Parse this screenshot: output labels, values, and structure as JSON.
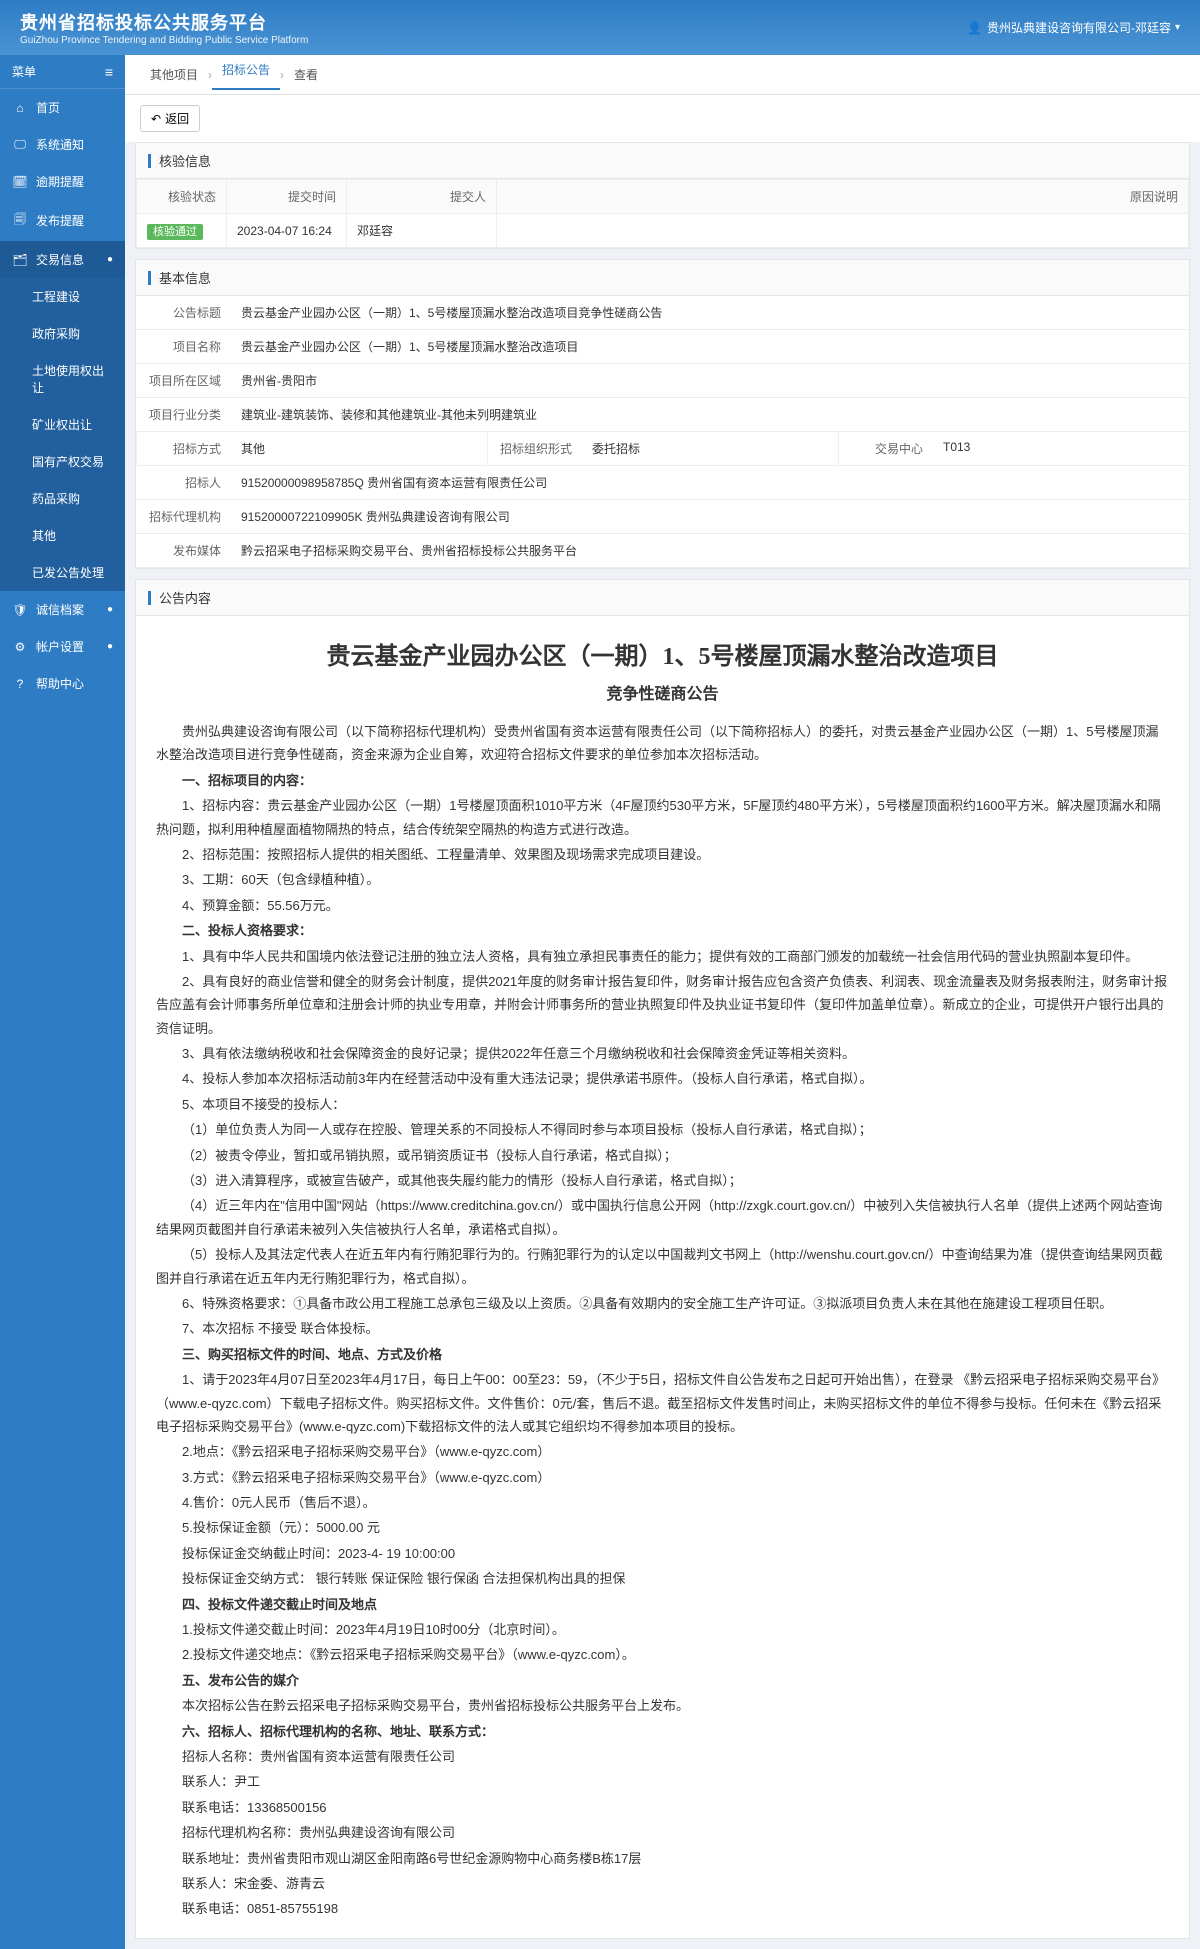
{
  "header": {
    "title": "贵州省招标投标公共服务平台",
    "subtitle": "GuiZhou Province Tendering and Bidding Public Service Platform",
    "user": "贵州弘典建设咨询有限公司-邓廷容"
  },
  "sidebar": {
    "menu_label": "菜单",
    "items": [
      {
        "label": "首页",
        "icon": "home"
      },
      {
        "label": "系统通知",
        "icon": "monitor"
      },
      {
        "label": "逾期提醒",
        "icon": "calendar"
      },
      {
        "label": "发布提醒",
        "icon": "send"
      },
      {
        "label": "交易信息",
        "icon": "trade",
        "expanded": true,
        "children": [
          {
            "label": "工程建设"
          },
          {
            "label": "政府采购"
          },
          {
            "label": "土地使用权出让"
          },
          {
            "label": "矿业权出让"
          },
          {
            "label": "国有产权交易"
          },
          {
            "label": "药品采购"
          },
          {
            "label": "其他"
          },
          {
            "label": "已发公告处理"
          }
        ]
      },
      {
        "label": "诚信档案",
        "icon": "credit",
        "chev": true
      },
      {
        "label": "帐户设置",
        "icon": "account",
        "chev": true
      },
      {
        "label": "帮助中心",
        "icon": "help"
      }
    ]
  },
  "breadcrumb": [
    "其他项目",
    "招标公告",
    "查看"
  ],
  "return_btn": "返回",
  "verify": {
    "title": "核验信息",
    "headers": [
      "核验状态",
      "提交时间",
      "提交人",
      "原因说明"
    ],
    "row": {
      "status": "核验通过",
      "time": "2023-04-07 16:24",
      "person": "邓廷容",
      "reason": ""
    }
  },
  "basic": {
    "title": "基本信息",
    "rows": [
      {
        "label": "公告标题",
        "value": "贵云基金产业园办公区（一期）1、5号楼屋顶漏水整治改造项目竞争性磋商公告"
      },
      {
        "label": "项目名称",
        "value": "贵云基金产业园办公区（一期）1、5号楼屋顶漏水整治改造项目"
      },
      {
        "label": "项目所在区域",
        "value": "贵州省-贵阳市"
      },
      {
        "label": "项目行业分类",
        "value": "建筑业-建筑装饰、装修和其他建筑业-其他未列明建筑业"
      }
    ],
    "multi": [
      {
        "label": "招标方式",
        "value": "其他"
      },
      {
        "label": "招标组织形式",
        "value": "委托招标"
      },
      {
        "label": "交易中心",
        "value": "T013"
      }
    ],
    "rows2": [
      {
        "label": "招标人",
        "value": "91520000098958785Q 贵州省国有资本运营有限责任公司"
      },
      {
        "label": "招标代理机构",
        "value": "91520000722109905K 贵州弘典建设咨询有限公司"
      },
      {
        "label": "发布媒体",
        "value": "黔云招采电子招标采购交易平台、贵州省招标投标公共服务平台"
      }
    ]
  },
  "content": {
    "title": "公告内容",
    "doc_title": "贵云基金产业园办公区（一期）1、5号楼屋顶漏水整治改造项目",
    "doc_subtitle": "竞争性磋商公告",
    "intro": "贵州弘典建设咨询有限公司（以下简称招标代理机构）受贵州省国有资本运营有限责任公司（以下简称招标人）的委托，对贵云基金产业园办公区（一期）1、5号楼屋顶漏水整治改造项目进行竞争性磋商，资金来源为企业自筹，欢迎符合招标文件要求的单位参加本次招标活动。",
    "s1": "一、招标项目的内容：",
    "s1_1": "1、招标内容：贵云基金产业园办公区（一期）1号楼屋顶面积1010平方米（4F屋顶约530平方米，5F屋顶约480平方米），5号楼屋顶面积约1600平方米。解决屋顶漏水和隔热问题，拟利用种植屋面植物隔热的特点，结合传统架空隔热的构造方式进行改造。",
    "s1_2": "2、招标范围：按照招标人提供的相关图纸、工程量清单、效果图及现场需求完成项目建设。",
    "s1_3": "3、工期：60天（包含绿植种植）。",
    "s1_4": "4、预算金额：55.56万元。",
    "s2": "二、投标人资格要求：",
    "s2_1": "1、具有中华人民共和国境内依法登记注册的独立法人资格，具有独立承担民事责任的能力；提供有效的工商部门颁发的加载统一社会信用代码的营业执照副本复印件。",
    "s2_2": "2、具有良好的商业信誉和健全的财务会计制度，提供2021年度的财务审计报告复印件，财务审计报告应包含资产负债表、利润表、现金流量表及财务报表附注，财务审计报告应盖有会计师事务所单位章和注册会计师的执业专用章，并附会计师事务所的营业执照复印件及执业证书复印件（复印件加盖单位章）。新成立的企业，可提供开户银行出具的资信证明。",
    "s2_3": "3、具有依法缴纳税收和社会保障资金的良好记录；提供2022年任意三个月缴纳税收和社会保障资金凭证等相关资料。",
    "s2_4": "4、投标人参加本次招标活动前3年内在经营活动中没有重大违法记录；提供承诺书原件。（投标人自行承诺，格式自拟）。",
    "s2_5": "5、本项目不接受的投标人：",
    "s2_5_1": "（1）单位负责人为同一人或存在控股、管理关系的不同投标人不得同时参与本项目投标（投标人自行承诺，格式自拟）；",
    "s2_5_2": "（2）被责令停业，暂扣或吊销执照，或吊销资质证书（投标人自行承诺，格式自拟）；",
    "s2_5_3": "（3）进入清算程序，或被宣告破产，或其他丧失履约能力的情形（投标人自行承诺，格式自拟）；",
    "s2_5_4": "（4）近三年内在\"信用中国\"网站（https://www.creditchina.gov.cn/）或中国执行信息公开网（http://zxgk.court.gov.cn/）中被列入失信被执行人名单（提供上述两个网站查询结果网页截图并自行承诺未被列入失信被执行人名单，承诺格式自拟）。",
    "s2_5_5": "（5）投标人及其法定代表人在近五年内有行贿犯罪行为的。行贿犯罪行为的认定以中国裁判文书网上（http://wenshu.court.gov.cn/）中查询结果为准（提供查询结果网页截图并自行承诺在近五年内无行贿犯罪行为，格式自拟）。",
    "s2_6": "6、特殊资格要求：①具备市政公用工程施工总承包三级及以上资质。②具备有效期内的安全施工生产许可证。③拟派项目负责人未在其他在施建设工程项目任职。",
    "s2_7": "7、本次招标 不接受 联合体投标。",
    "s3": "三、购买招标文件的时间、地点、方式及价格",
    "s3_1": "1、请于2023年4月07日至2023年4月17日，每日上午00：00至23：59，（不少于5日，招标文件自公告发布之日起可开始出售），在登录 《黔云招采电子招标采购交易平台》（www.e-qyzc.com）下载电子招标文件。购买招标文件。文件售价：0元/套，售后不退。截至招标文件发售时间止，未购买招标文件的单位不得参与投标。任何未在《黔云招采电子招标采购交易平台》(www.e-qyzc.com)下载招标文件的法人或其它组织均不得参加本项目的投标。",
    "s3_2": "2.地点：《黔云招采电子招标采购交易平台》（www.e-qyzc.com）",
    "s3_3": "3.方式：《黔云招采电子招标采购交易平台》（www.e-qyzc.com）",
    "s3_4": "4.售价：0元人民币（售后不退）。",
    "s3_5": "5.投标保证金额（元）：5000.00 元",
    "s3_6": "投标保证金交纳截止时间：2023-4- 19 10:00:00",
    "s3_7": "投标保证金交纳方式：  银行转账  保证保险  银行保函  合法担保机构出具的担保",
    "s4": "四、投标文件递交截止时间及地点",
    "s4_1": "1.投标文件递交截止时间：2023年4月19日10时00分（北京时间）。",
    "s4_2": "2.投标文件递交地点：《黔云招采电子招标采购交易平台》（www.e-qyzc.com）。",
    "s5": "五、发布公告的媒介",
    "s5_1": "本次招标公告在黔云招采电子招标采购交易平台，贵州省招标投标公共服务平台上发布。",
    "s6": "六、招标人、招标代理机构的名称、地址、联系方式：",
    "s6_1": "招标人名称：贵州省国有资本运营有限责任公司",
    "s6_2": "联系人：尹工",
    "s6_3": "联系电话：13368500156",
    "s6_4": "招标代理机构名称：贵州弘典建设咨询有限公司",
    "s6_5": "联系地址：贵州省贵阳市观山湖区金阳南路6号世纪金源购物中心商务楼B栋17层",
    "s6_6": "联系人：宋金委、游青云",
    "s6_7": "联系电话：0851-85755198"
  }
}
